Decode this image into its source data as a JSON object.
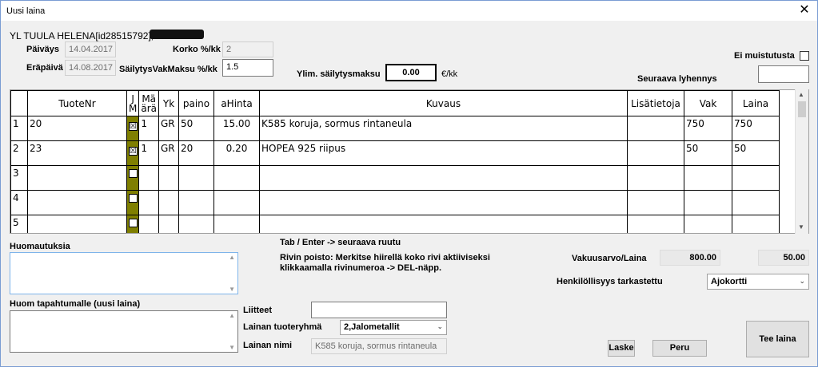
{
  "window": {
    "title": "Uusi laina",
    "close_symbol": "✕"
  },
  "customer": {
    "name": "YL TUULA HELENA[id28515792],"
  },
  "fields": {
    "paivays_label": "Päiväys",
    "paivays_value": "14.04.2017",
    "erapaiva_label": "Eräpäivä",
    "erapaiva_value": "14.08.2017",
    "korko_label": "Korko %/kk",
    "korko_value": "2",
    "sailytys_label": "SäilytysVakMaksu %/kk",
    "sailytys_value": "1.5",
    "ylim_label": "Ylim. säilytysmaksu",
    "ylim_value": "0.00",
    "ylim_unit": "€/kk",
    "ei_muistutusta_label": "Ei muistutusta",
    "seuraava_label": "Seuraava lyhennys",
    "seuraava_value": ""
  },
  "grid": {
    "headers": [
      "",
      "TuoteNr",
      "JM",
      "Määrä",
      "Yk",
      "paino",
      "aHinta",
      "Kuvaus",
      "Lisätietoja",
      "Vak",
      "Laina"
    ],
    "jm_header_top": "J",
    "jm_header_bottom": "M",
    "maara_header_top": "Mä",
    "maara_header_bottom": "ärä",
    "rows": [
      {
        "n": "1",
        "tuotenr": "20",
        "jm": "☒",
        "maara": "1",
        "yk": "GR",
        "paino": "50",
        "ahinta": "15.00",
        "kuvaus": "K585 koruja, sormus rintaneula",
        "lisatietoja": "",
        "vak": "750",
        "laina": "750"
      },
      {
        "n": "2",
        "tuotenr": "23",
        "jm": "☒",
        "maara": "1",
        "yk": "GR",
        "paino": "20",
        "ahinta": "0.20",
        "kuvaus": "HOPEA 925 riipus",
        "lisatietoja": "",
        "vak": "50",
        "laina": "50"
      },
      {
        "n": "3",
        "tuotenr": "",
        "jm": "",
        "maara": "",
        "yk": "",
        "paino": "",
        "ahinta": "",
        "kuvaus": "",
        "lisatietoja": "",
        "vak": "",
        "laina": ""
      },
      {
        "n": "4",
        "tuotenr": "",
        "jm": "",
        "maara": "",
        "yk": "",
        "paino": "",
        "ahinta": "",
        "kuvaus": "",
        "lisatietoja": "",
        "vak": "",
        "laina": ""
      },
      {
        "n": "5",
        "tuotenr": "",
        "jm": "",
        "maara": "",
        "yk": "",
        "paino": "",
        "ahinta": "",
        "kuvaus": "",
        "lisatietoja": "",
        "vak": "",
        "laina": ""
      }
    ]
  },
  "notes": {
    "huomautuksia_label": "Huomautuksia",
    "huom_tapahtumalle_label": "Huom tapahtumalle (uusi laina)"
  },
  "help": {
    "line1": "Tab / Enter -> seuraava ruutu",
    "line2": "Rivin poisto: Merkitse hiirellä koko rivi aktiiviseksi",
    "line3": "klikkaamalla rivinumeroa -> DEL-näpp."
  },
  "totals": {
    "label": "Vakuusarvo/Laina",
    "vakuusarvo": "800.00",
    "laina": "50.00"
  },
  "identity": {
    "label": "Henkilöllisyys tarkastettu",
    "value": "Ajokortti"
  },
  "loan": {
    "liitteet_label": "Liitteet",
    "liitteet_value": "",
    "tuoteryhma_label": "Lainan tuoteryhmä",
    "tuoteryhma_value": "2,Jalometallit",
    "nimi_label": "Lainan nimi",
    "nimi_value": "K585 koruja, sormus rintaneula"
  },
  "buttons": {
    "laske": "Laske",
    "peru": "Peru",
    "tee_laina": "Tee laina"
  }
}
